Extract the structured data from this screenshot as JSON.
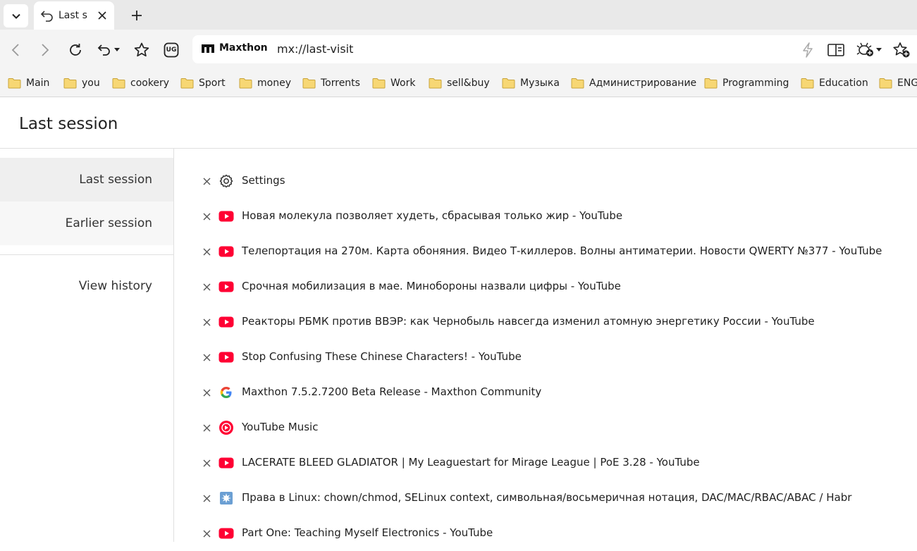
{
  "tab": {
    "title": "Last s"
  },
  "toolbar": {
    "brand": "Maxthon",
    "url": "mx://last-visit",
    "ug_badge": "UG"
  },
  "bookmarks": [
    {
      "label": "Main"
    },
    {
      "label": "you"
    },
    {
      "label": "cookery"
    },
    {
      "label": "Sport"
    },
    {
      "label": "money"
    },
    {
      "label": "Torrents"
    },
    {
      "label": "Work"
    },
    {
      "label": "sell&buy"
    },
    {
      "label": "Музыка"
    },
    {
      "label": "Администрирование"
    },
    {
      "label": "Programming"
    },
    {
      "label": "Education"
    },
    {
      "label": "ENG"
    }
  ],
  "page": {
    "title": "Last session"
  },
  "sidebar": {
    "items": [
      {
        "label": "Last session"
      },
      {
        "label": "Earlier session"
      },
      {
        "label": "View history"
      }
    ]
  },
  "sessions": [
    {
      "icon": "gear-icon",
      "title": "Settings"
    },
    {
      "icon": "youtube-icon",
      "title": "Новая молекула позволяет худеть, сбрасывая только жир - YouTube"
    },
    {
      "icon": "youtube-icon",
      "title": "Телепортация на 270м. Карта обоняния. Видео Т-киллеров. Волны антиматерии. Новости QWERTY №377 - YouTube"
    },
    {
      "icon": "youtube-icon",
      "title": "Срочная мобилизация в мае. Минобороны назвали цифры - YouTube"
    },
    {
      "icon": "youtube-icon",
      "title": "Реакторы РБМК против ВВЭР: как Чернобыль навсегда изменил атомную энергетику России - YouTube"
    },
    {
      "icon": "youtube-icon",
      "title": "Stop Confusing These Chinese Characters! - YouTube"
    },
    {
      "icon": "google-icon",
      "title": "Maxthon 7.5.2.7200 Beta Release - Maxthon Community"
    },
    {
      "icon": "youtube-music-icon",
      "title": "YouTube Music"
    },
    {
      "icon": "youtube-icon",
      "title": "LACERATE BLEED GLADIATOR | My Leaguestart for Mirage League | PoE 3.28 - YouTube"
    },
    {
      "icon": "habr-icon",
      "title": "Права в Linux: chown/chmod, SELinux context, символьная/восьмеричная нотация, DAC/MAC/RBAC/ABAC / Habr"
    },
    {
      "icon": "youtube-icon",
      "title": "Part One: Teaching Myself Electronics - YouTube"
    }
  ],
  "colors": {
    "youtube_red": "#ff0033",
    "folder_fill": "#f7d774",
    "folder_stroke": "#c9a43b"
  }
}
